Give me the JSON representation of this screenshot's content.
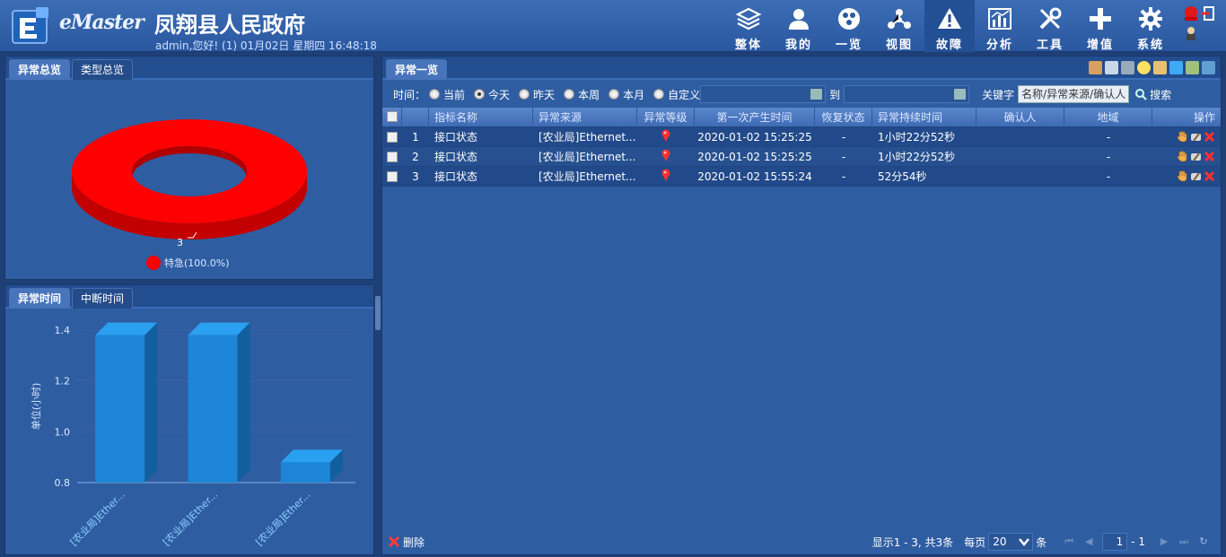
{
  "header": {
    "brand": "eMaster",
    "site_title": "凤翔县人民政府",
    "user_line": "admin,您好! (1) 01月02日 星期四 16:48:18",
    "nav": [
      {
        "label": "整体",
        "icon": "layers-icon"
      },
      {
        "label": "我的",
        "icon": "user-icon"
      },
      {
        "label": "一览",
        "icon": "overview-icon"
      },
      {
        "label": "视图",
        "icon": "topology-icon"
      },
      {
        "label": "故障",
        "icon": "warning-icon",
        "active": true
      },
      {
        "label": "分析",
        "icon": "chart-icon"
      },
      {
        "label": "工具",
        "icon": "tools-icon"
      },
      {
        "label": "增值",
        "icon": "plus-icon"
      },
      {
        "label": "系统",
        "icon": "gear-icon"
      }
    ]
  },
  "left_top": {
    "tabs": [
      "异常总览",
      "类型总览"
    ],
    "chart_data": {
      "type": "pie",
      "categories": [
        "特急"
      ],
      "values": [
        3
      ],
      "data_labels": [
        "3"
      ],
      "legend": [
        "特急(100.0%)"
      ],
      "colors": [
        "#ff0000"
      ],
      "legend_position": "bottom"
    }
  },
  "left_bottom": {
    "tabs": [
      "异常时间",
      "中断时间"
    ],
    "chart_data": {
      "type": "bar",
      "categories": [
        "[农业局]Ether...",
        "[农业局]Ether...",
        "[农业局]Ether..."
      ],
      "values": [
        1.38,
        1.38,
        0.88
      ],
      "ylabel": "单位(小时)",
      "ylim": [
        0.8,
        1.4
      ],
      "yticks": [
        "0.8",
        "1.0",
        "1.2",
        "1.4"
      ],
      "grid": true,
      "color": "#1d86d8"
    }
  },
  "right": {
    "tab": "异常一览",
    "filter": {
      "time_label": "时间：",
      "options": [
        "当前",
        "今天",
        "昨天",
        "本周",
        "本月",
        "自定义"
      ],
      "selected": "今天",
      "to_label": "到",
      "keyword_label": "关键字",
      "keyword_placeholder": "名称/异常来源/确认人",
      "search_label": "搜索"
    },
    "columns": [
      "",
      "",
      "指标名称",
      "异常来源",
      "异常等级",
      "第一次产生时间",
      "恢复状态",
      "异常持续时间",
      "确认人",
      "地域",
      "操作"
    ],
    "rows": [
      {
        "no": "1",
        "name": "接口状态",
        "source": "[农业局]Ethernet...",
        "first_time": "2020-01-02 15:25:25",
        "recovery": "-",
        "duration": "1小时22分52秒",
        "confirmer": "",
        "region": "-"
      },
      {
        "no": "2",
        "name": "接口状态",
        "source": "[农业局]Ethernet...",
        "first_time": "2020-01-02 15:25:25",
        "recovery": "-",
        "duration": "1小时22分52秒",
        "confirmer": "",
        "region": "-"
      },
      {
        "no": "3",
        "name": "接口状态",
        "source": "[农业局]Ethernet...",
        "first_time": "2020-01-02 15:55:24",
        "recovery": "-",
        "duration": "52分54秒",
        "confirmer": "",
        "region": "-"
      }
    ],
    "footer": {
      "delete_label": "删除",
      "summary": "显示1 - 3, 共3条",
      "per_page_label": "每页",
      "per_page_value": "20",
      "per_page_unit": "条",
      "page": "1",
      "page_total": "- 1"
    }
  }
}
